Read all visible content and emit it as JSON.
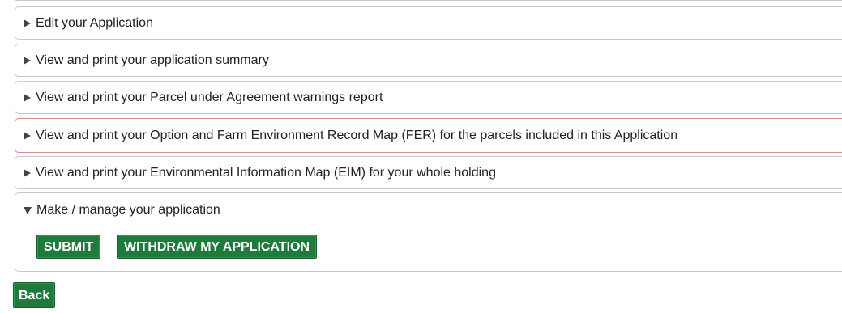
{
  "sections": [
    {
      "label": "Edit your Application"
    },
    {
      "label": "View and print your application summary"
    },
    {
      "label": "View and print your Parcel under Agreement warnings report"
    },
    {
      "label": "View and print your Option and Farm Environment Record Map (FER) for the parcels included in this Application"
    },
    {
      "label": "View and print your Environmental Information Map (EIM) for your whole holding"
    }
  ],
  "manage": {
    "label": "Make / manage your application",
    "submit_label": "SUBMIT",
    "withdraw_label": "WITHDRAW MY APPLICATION"
  },
  "back_label": "Back",
  "colors": {
    "button_green": "#1e7b3b",
    "highlight_border": "#d98a8a"
  }
}
